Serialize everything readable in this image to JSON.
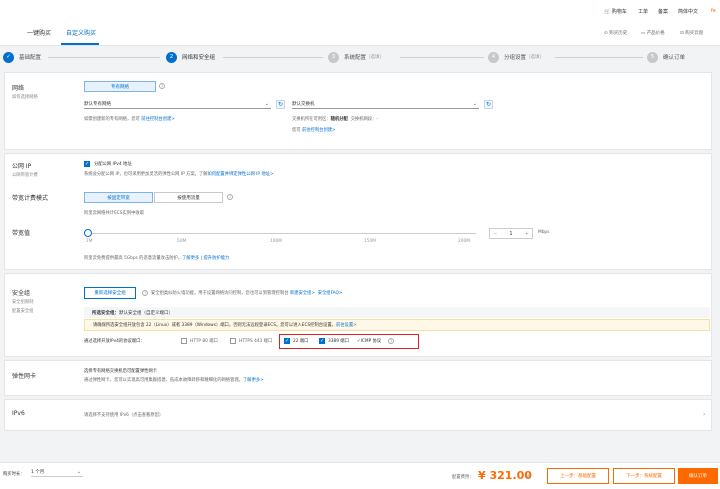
{
  "header": {
    "cart": "购物车",
    "ticket": "工单",
    "filing": "备案",
    "lang": "简体中文",
    "tabs": [
      "一键购买",
      "自定义购买"
    ],
    "links": [
      "购买历史",
      "产品价格",
      "购买云盘"
    ]
  },
  "steps": [
    {
      "num": "✓",
      "label": "基础配置"
    },
    {
      "num": "2",
      "label": "网络和安全组"
    },
    {
      "num": "3",
      "label": "系统配置",
      "note": "（选填）"
    },
    {
      "num": "4",
      "label": "分组设置",
      "note": "（选填）"
    },
    {
      "num": "5",
      "label": "确认订单"
    }
  ],
  "network": {
    "title": "网络",
    "sub": "如何选择网络",
    "vpc_btn": "专有网络",
    "vpc_select": "默认专有网络",
    "vswitch_select": "默认交换机",
    "vpc_hint": "如需创建新的专有网络，您可",
    "vpc_hint_link": "前往控制台创建>",
    "vswitch_zone_label": "交换机所在可用区：",
    "vswitch_zone": "随机分配",
    "vswitch_cidr_label": "交换机网段：",
    "vswitch_cidr": "-",
    "vswitch_hint": "您可",
    "vswitch_hint_link": "前往控制台创建>"
  },
  "public_ip": {
    "title": "公网 IP",
    "sub": "公网带宽计费",
    "checkbox": "分配公网 IPv4 地址",
    "desc": "系统会分配公网 IP，也可采用更加灵活的弹性公网 IP 方案，了解",
    "desc_link": "如何配置并绑定弹性公网 IP 地址>"
  },
  "bandwidth_billing": {
    "title": "带宽计费模式",
    "options": [
      "按固定带宽",
      "按使用流量"
    ],
    "desc": "阿里云网络共计ECS实例中收取"
  },
  "bandwidth": {
    "title": "带宽值",
    "ticks": [
      "1M",
      "50M",
      "100M",
      "150M",
      "200M"
    ],
    "value": "1",
    "unit": "Mbps",
    "desc": "阿里云免费提供最高 5Gbps 的恶意流量攻击防护，",
    "desc_link1": "了解更多",
    "desc_link2": "提升防护能力"
  },
  "security_group": {
    "title": "安全组",
    "sub1": "安全组限制",
    "sub2": "配置安全组",
    "reselect_btn": "重新选择安全组",
    "desc": "安全组类似防火墙功能，用于设置网络访问控制，您也可以到管理控制台",
    "desc_link1": "新建安全组>",
    "desc_link2": "安全组FAQ>",
    "selected_label": "所选安全组：",
    "selected_value": "默认安全组（自定义端口）",
    "warning": "请确保所选安全组开放包含 22（Linux）或者 3389（Windows）端口，否则无法远程登录ECS。您可以进入ECS控制台设置。",
    "warning_link": "前往设置>",
    "ports_label": "通过选择开放IPv4的协议端口：",
    "ports": [
      {
        "label": "HTTP 80 端口",
        "checked": false
      },
      {
        "label": "HTTPS 443 端口",
        "checked": false
      },
      {
        "label": "22 端口",
        "checked": true
      },
      {
        "label": "3389 端口",
        "checked": true
      },
      {
        "label": "ICMP 协议",
        "checked": true
      }
    ]
  },
  "eni": {
    "title": "弹性网卡",
    "line1": "选择专有网络交换机后可配置弹性网卡",
    "line2": "通过弹性网卡，您可以实现高可用集群搭建、低成本故障转移和精细化的网络管理。",
    "link": "了解更多>"
  },
  "ipv6": {
    "title": "IPv6",
    "desc": "请选择不支持使用 IPv6（点击查看原因）"
  },
  "footer": {
    "duration_label": "购买时长：",
    "duration_value": "1 个月",
    "price_label": "配置费用：",
    "price": "¥ 321.00",
    "price_note": "省",
    "prev_btn": "上一步：基础配置",
    "next_btn": "下一步：系统配置",
    "confirm_btn": "确认订单"
  },
  "colors": {
    "accent": "#0070cc",
    "orange": "#ff6a00",
    "highlight": "#e0201f"
  }
}
